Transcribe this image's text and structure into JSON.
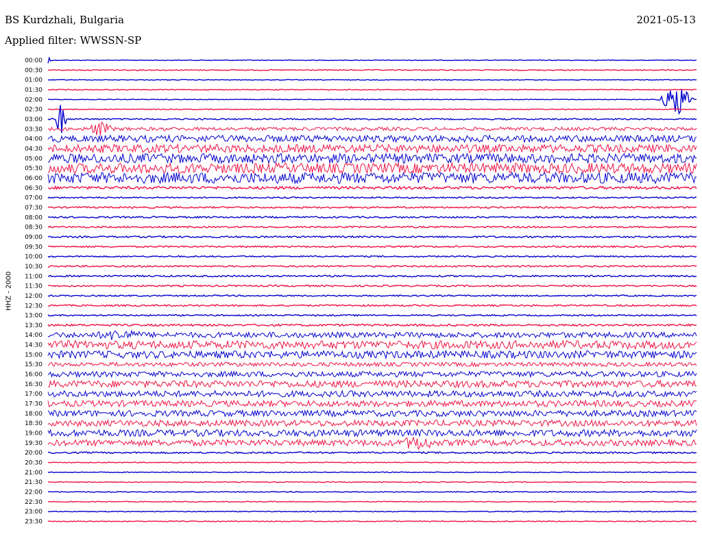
{
  "header": {
    "station": "BS Kurdzhali, Bulgaria",
    "date": "2021-05-13",
    "filter": "Applied filter: WWSSN-SP"
  },
  "chart_data": {
    "type": "line",
    "description_key": "helicorder",
    "ylabel": "HHZ - 2000",
    "row_labels": [
      "00:00",
      "00:30",
      "01:00",
      "01:30",
      "02:00",
      "02:30",
      "03:00",
      "03:30",
      "04:00",
      "04:30",
      "05:00",
      "05:30",
      "06:00",
      "06:30",
      "07:00",
      "07:30",
      "08:00",
      "08:30",
      "09:00",
      "09:30",
      "10:00",
      "10:30",
      "11:00",
      "11:30",
      "12:00",
      "12:30",
      "13:00",
      "13:30",
      "14:00",
      "14:30",
      "15:00",
      "15:30",
      "16:00",
      "16:30",
      "17:00",
      "17:30",
      "18:00",
      "18:30",
      "19:00",
      "19:30",
      "20:00",
      "20:30",
      "21:00",
      "21:30",
      "22:00",
      "22:30",
      "23:00",
      "23:30"
    ],
    "trace_colors": [
      "#0000cc",
      "#ee1144"
    ],
    "noise_level": [
      0.5,
      0.7,
      0.5,
      0.6,
      0.5,
      0.6,
      1.0,
      2.5,
      5.0,
      6.0,
      7.0,
      7.5,
      8.0,
      2.0,
      1.0,
      1.2,
      1.2,
      1.2,
      1.2,
      1.2,
      1.0,
      1.2,
      1.2,
      1.2,
      1.0,
      1.2,
      1.0,
      1.5,
      4.0,
      6.0,
      5.5,
      3.0,
      4.0,
      5.0,
      4.5,
      4.5,
      4.5,
      4.5,
      5.0,
      4.5,
      1.2,
      0.6,
      0.6,
      0.6,
      0.6,
      0.6,
      0.6,
      0.6
    ],
    "events": [
      {
        "row": 0,
        "x_frac": 0.0,
        "amp": 14,
        "width": 0.005
      },
      {
        "row": 6,
        "x_frac": 0.02,
        "amp": 30,
        "width": 0.01
      },
      {
        "row": 7,
        "x_frac": 0.08,
        "amp": 12,
        "width": 0.03
      },
      {
        "row": 28,
        "x_frac": 0.11,
        "amp": 10,
        "width": 0.06
      },
      {
        "row": 4,
        "x_frac": 0.97,
        "amp": 25,
        "width": 0.03
      },
      {
        "row": 39,
        "x_frac": 0.57,
        "amp": 12,
        "width": 0.05
      }
    ]
  }
}
